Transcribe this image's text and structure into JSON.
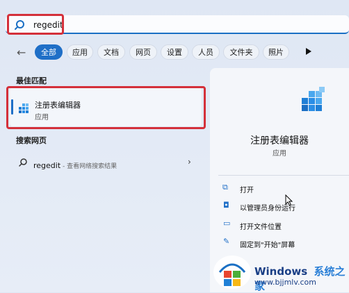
{
  "search": {
    "query": "regedit"
  },
  "filters": {
    "back_icon": "back-arrow-icon",
    "items": [
      "全部",
      "应用",
      "文档",
      "网页",
      "设置",
      "人员",
      "文件夹",
      "照片"
    ],
    "active": "全部"
  },
  "best_match": {
    "section_title": "最佳匹配",
    "title": "注册表编辑器",
    "subtitle": "应用"
  },
  "web": {
    "section_title": "搜索网页",
    "query": "regedit",
    "suffix": " - 查看网络搜索结果"
  },
  "detail": {
    "title": "注册表编辑器",
    "subtitle": "应用",
    "actions": [
      {
        "label": "打开",
        "icon": "open-external-icon"
      },
      {
        "label": "以管理员身份运行",
        "icon": "shield-admin-icon"
      },
      {
        "label": "打开文件位置",
        "icon": "folder-icon"
      },
      {
        "label": "固定到\"开始\"屏幕",
        "icon": "pin-icon"
      }
    ]
  },
  "watermark": {
    "brand": "Windows",
    "cn": "系统之家",
    "url": "www.bjjmlv.com"
  },
  "colors": {
    "accent": "#1f6fc7",
    "highlight": "#d4303a"
  }
}
